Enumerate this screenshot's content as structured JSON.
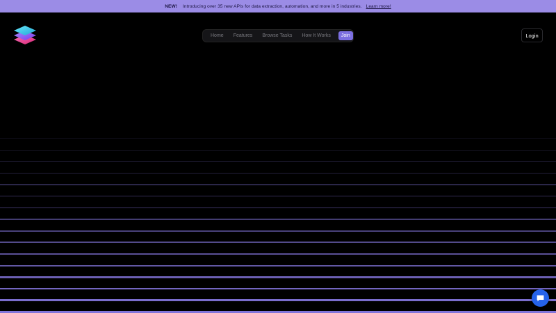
{
  "banner": {
    "badge": "NEW!",
    "text": "Introducing over 35 new APIs for data extraction, automation, and more in 5 industries.",
    "link": "Learn more!"
  },
  "logo": {
    "icon": "stacked-layers-logo",
    "colors": [
      "#4fd1e8",
      "#8b5cf6",
      "#ec4899"
    ]
  },
  "nav": {
    "items": [
      {
        "label": "Home"
      },
      {
        "label": "Features"
      },
      {
        "label": "Browse Tasks"
      },
      {
        "label": "How It Works"
      }
    ],
    "join_label": "Join"
  },
  "login_label": "Login",
  "chat": {
    "icon": "chat-bubble-icon",
    "color": "#2563eb"
  },
  "theme": {
    "accent": "#7b6ee0",
    "banner_bg": "#9b8ce6",
    "background": "#000000"
  }
}
